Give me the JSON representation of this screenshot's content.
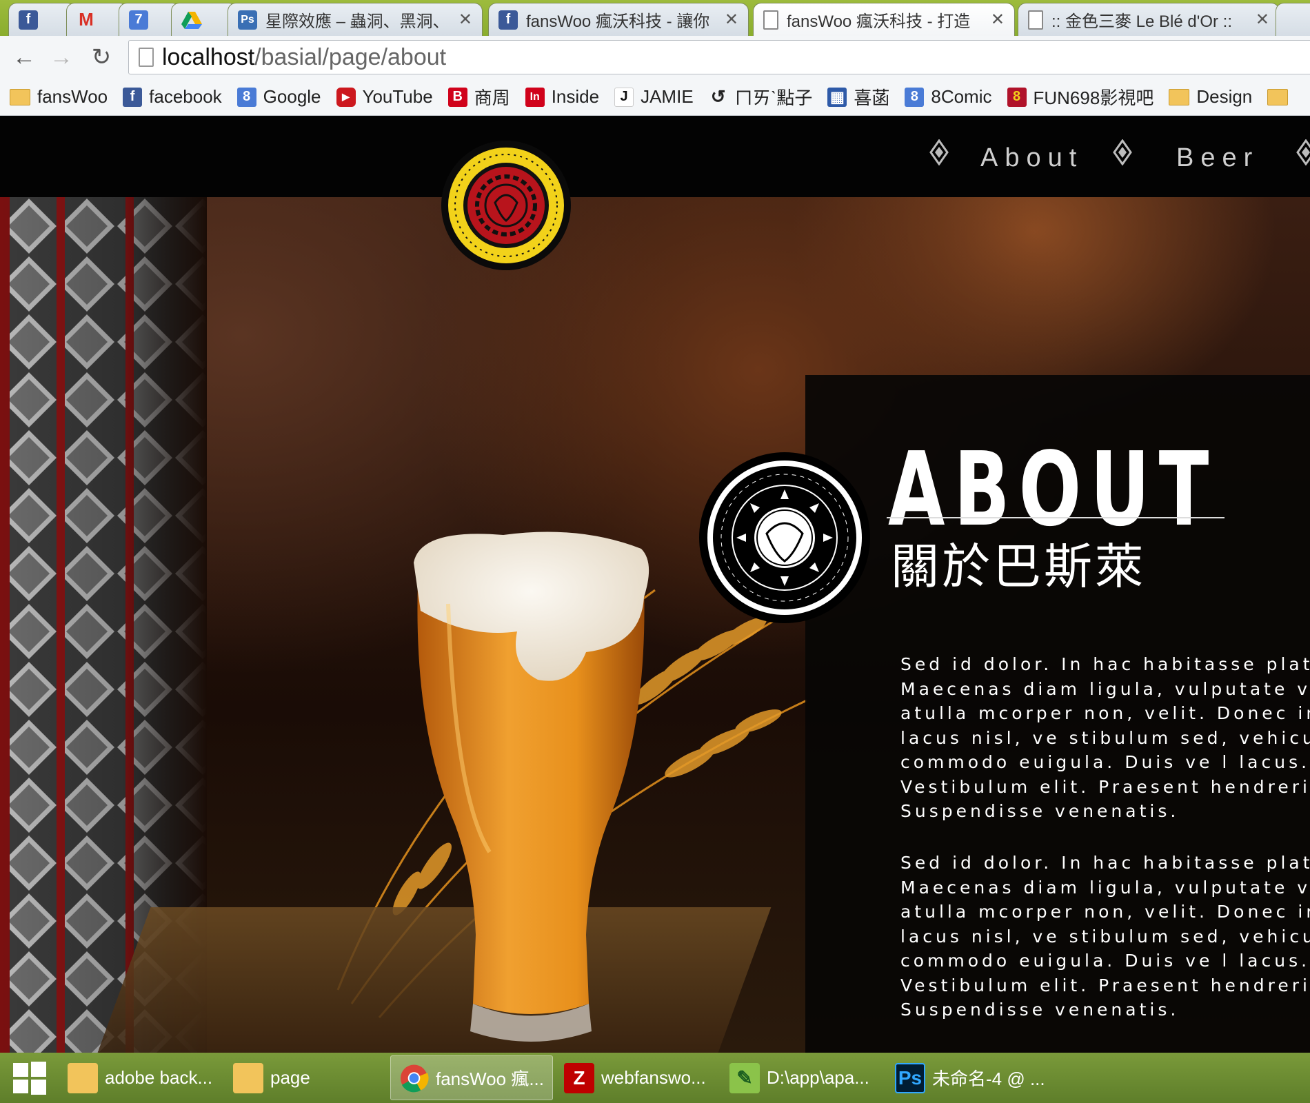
{
  "browser": {
    "tabs": [
      {
        "label": "",
        "icon": "facebook-icon"
      },
      {
        "label": "",
        "icon": "gmail-icon"
      },
      {
        "label": "",
        "icon": "calendar-icon"
      },
      {
        "label": "",
        "icon": "drive-icon"
      },
      {
        "label": "星際效應 – 蟲洞、黑洞、",
        "icon": "page-icon"
      },
      {
        "label": "fansWoo 瘋沃科技 - 讓你",
        "icon": "facebook-icon"
      },
      {
        "label": "fansWoo 瘋沃科技 - 打造",
        "icon": "page-icon"
      },
      {
        "label": ":: 金色三麥 Le Blé d'Or ::",
        "icon": "page-icon"
      }
    ],
    "address": {
      "host": "localhost",
      "path": "/basial/page/about"
    },
    "bookmarks": [
      {
        "label": "fansWoo",
        "icon": "folder-icon"
      },
      {
        "label": "facebook",
        "icon": "facebook-icon",
        "color": "#3b5998",
        "glyph": "f"
      },
      {
        "label": "Google",
        "icon": "google-icon",
        "color": "#4a7bd6",
        "glyph": "8"
      },
      {
        "label": "YouTube",
        "icon": "youtube-icon",
        "color": "#cc181e",
        "glyph": "▶"
      },
      {
        "label": "商周",
        "icon": "businessweekly-icon",
        "color": "#d0021b",
        "glyph": "B"
      },
      {
        "label": "Inside",
        "icon": "inside-icon",
        "color": "#d0021b",
        "glyph": "In"
      },
      {
        "label": "JAMIE",
        "icon": "jamie-icon",
        "color": "#ffffff",
        "glyph": "J"
      },
      {
        "label": "ㄇㄞˋ點子",
        "icon": "swirl-icon",
        "color": "#f4f6f8",
        "glyph": "↺"
      },
      {
        "label": "喜菡",
        "icon": "grid-icon",
        "color": "#2e5aa8",
        "glyph": "▦"
      },
      {
        "label": "8Comic",
        "icon": "8comic-icon",
        "color": "#4a7bd6",
        "glyph": "8"
      },
      {
        "label": "FUN698影視吧",
        "icon": "fun698-icon",
        "color": "#b0122a",
        "glyph": "8"
      },
      {
        "label": "Design",
        "icon": "folder-icon"
      },
      {
        "label": "",
        "icon": "folder-icon"
      }
    ]
  },
  "site": {
    "nav": [
      {
        "label": "About"
      },
      {
        "label": "Beer"
      }
    ],
    "about": {
      "heading": "ABOUT",
      "subheading": "關於巴斯萊",
      "para1": [
        "Sed id dolor. In hac habitasse plate",
        "Maecenas diam ligula, vulputate vit",
        "atulla mcorper non, velit. Donec in",
        "lacus nisl, ve stibulum sed, vehicula",
        "commodo euigula. Duis ve l lacus. I",
        "Vestibulum elit. Praesent hendreri t",
        "Suspendisse venenatis."
      ],
      "para2": [
        "Sed id dolor. In hac habitasse plate",
        "Maecenas diam ligula, vulputate vit",
        "atulla mcorper non, velit. Donec in",
        "lacus nisl, ve stibulum sed, vehicula",
        "commodo euigula. Duis ve l lacus. I",
        "Vestibulum elit. Praesent hendreri t",
        "Suspendisse venenatis."
      ]
    },
    "colors": {
      "badge_yellow": "#f2d21a",
      "badge_red": "#b8141c",
      "beer": "#e08a1a",
      "foam": "#f3ede2"
    }
  },
  "taskbar": {
    "items": [
      {
        "label": "adobe back...",
        "icon": "folder-icon"
      },
      {
        "label": "page",
        "icon": "folder-icon"
      },
      {
        "label": "fansWoo 瘋...",
        "icon": "chrome-icon",
        "active": true
      },
      {
        "label": "webfanswo...",
        "icon": "filezilla-icon"
      },
      {
        "label": "D:\\app\\apa...",
        "icon": "notepad-icon"
      },
      {
        "label": "未命名-4 @ ...",
        "icon": "photoshop-icon"
      }
    ]
  }
}
